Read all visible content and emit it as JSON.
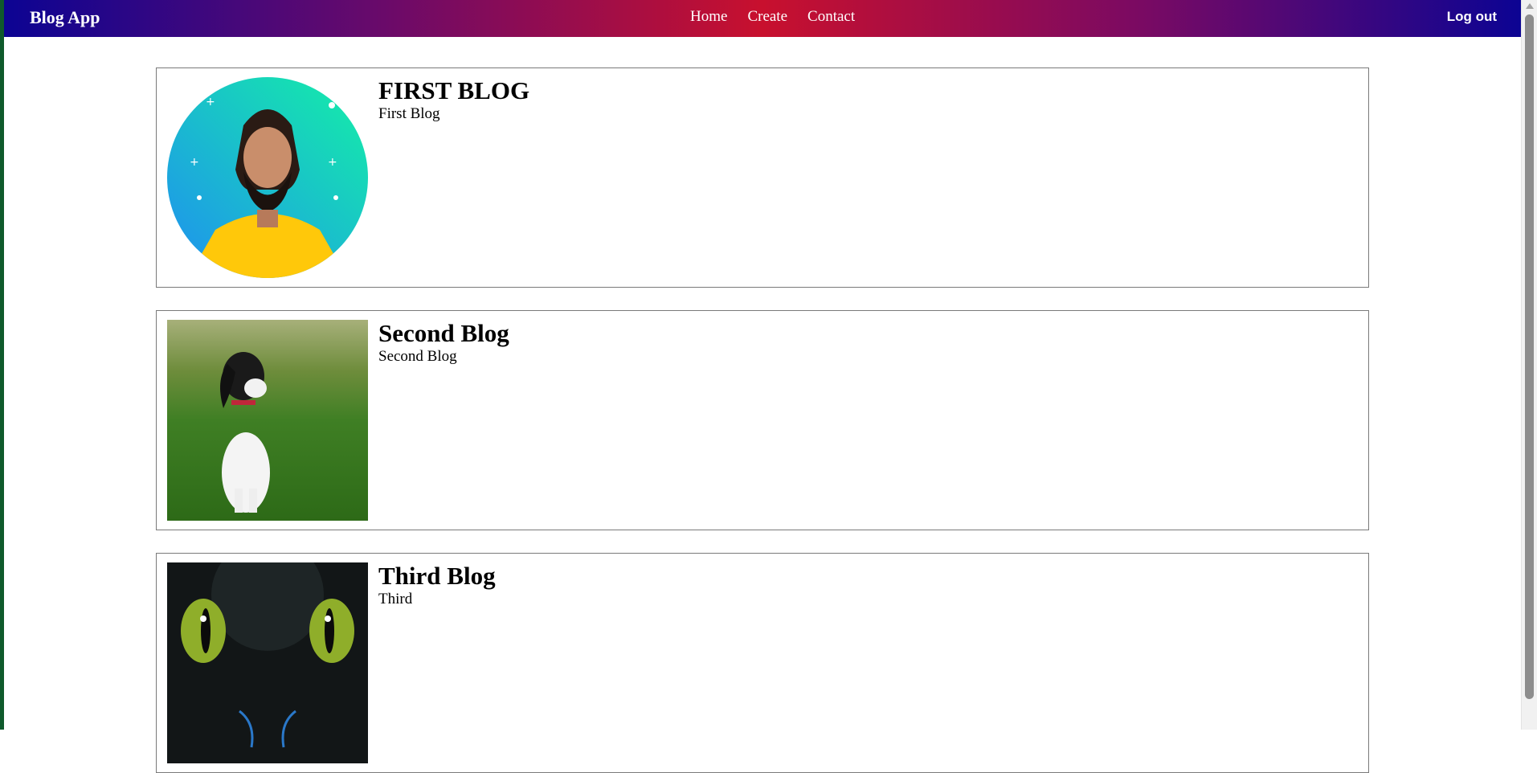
{
  "app": {
    "brand": "Blog App"
  },
  "nav": {
    "links": [
      "Home",
      "Create",
      "Contact"
    ],
    "logout": "Log out"
  },
  "colors": {
    "navbar_gradient": [
      "#0c0493",
      "#c8102e",
      "#0c0493"
    ],
    "card_border": "#7a7a7a"
  },
  "blogs": [
    {
      "title": "FIRST BLOG",
      "description": "First Blog",
      "image": "portrait-avatar"
    },
    {
      "title": "Second Blog",
      "description": "Second Blog",
      "image": "puppy-in-grass"
    },
    {
      "title": "Third Blog",
      "description": "Third",
      "image": "dragon-eyes"
    }
  ]
}
